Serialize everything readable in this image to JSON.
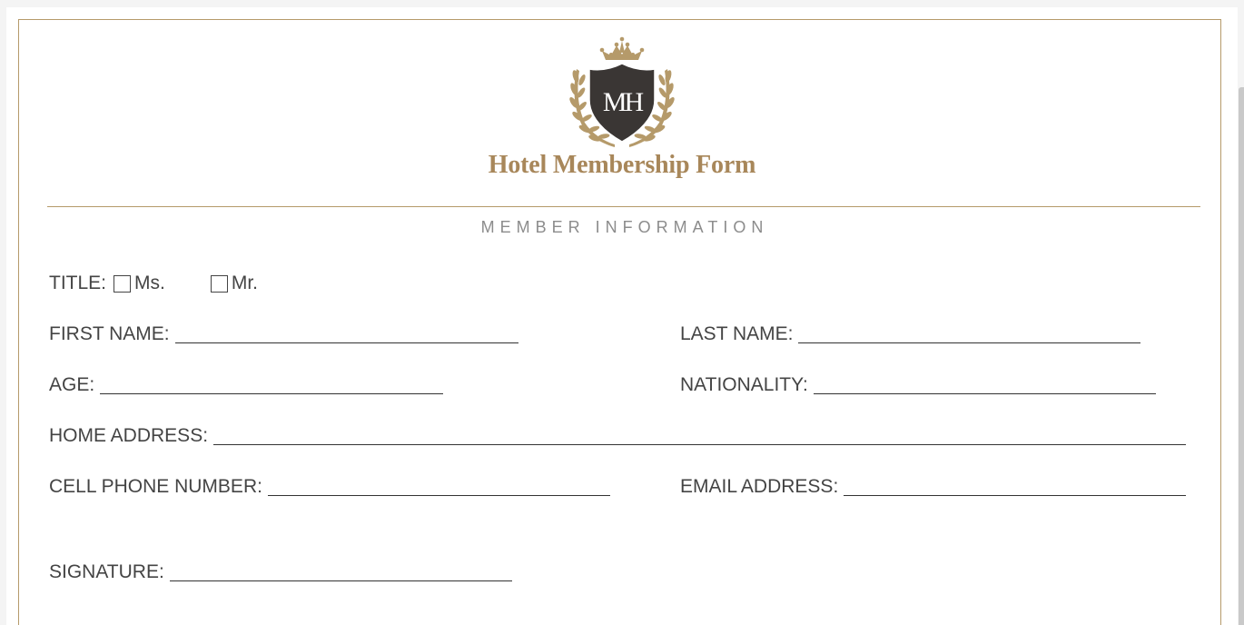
{
  "form": {
    "logo_monogram": "MH",
    "title": "Hotel Membership Form",
    "section_heading": "MEMBER INFORMATION"
  },
  "colors": {
    "accent_gold": "#b59a6a",
    "title_gold": "#a8875a",
    "shield_dark": "#3a3634",
    "text": "#444444"
  },
  "fields": {
    "title": {
      "label": "TITLE:",
      "options": [
        "Ms.",
        "Mr."
      ]
    },
    "first_name": {
      "label": "FIRST NAME:"
    },
    "last_name": {
      "label": "LAST NAME:"
    },
    "age": {
      "label": "AGE:"
    },
    "nationality": {
      "label": "NATIONALITY:"
    },
    "home_address": {
      "label": "HOME ADDRESS:"
    },
    "cell_phone": {
      "label": "CELL PHONE NUMBER:"
    },
    "email": {
      "label": "EMAIL ADDRESS:"
    },
    "signature": {
      "label": "SIGNATURE:"
    }
  }
}
